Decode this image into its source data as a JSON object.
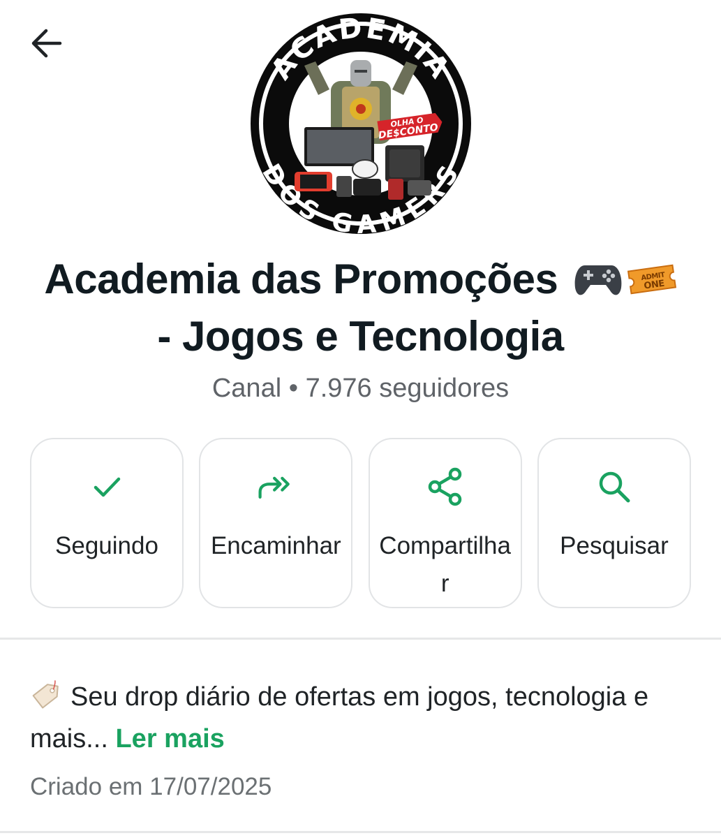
{
  "header": {
    "back_icon": "arrow-left-icon"
  },
  "logo": {
    "top_text": "ACADEMIA",
    "bottom_text": "DOS GAMERS",
    "tag_line1": "OLHA O",
    "tag_line2": "DE$CONTO"
  },
  "channel": {
    "title_line1": "Academia das Promoções",
    "title_line2": "- Jogos e Tecnologia",
    "ticket_text_top": "ADMIT",
    "ticket_text_bottom": "ONE",
    "subtitle": "Canal • 7.976 seguidores"
  },
  "actions": [
    {
      "label": "Seguindo",
      "icon": "check-icon"
    },
    {
      "label": "Encaminhar",
      "icon": "forward-icon"
    },
    {
      "label": "Compartilhar",
      "icon": "share-icon"
    },
    {
      "label": "Pesquisar",
      "icon": "search-icon"
    }
  ],
  "description": {
    "text": "Seu drop diário de ofertas em jogos, tecnologia e mais...",
    "read_more": "Ler mais",
    "icon": "price-tag-icon"
  },
  "created": "Criado em 17/07/2025",
  "colors": {
    "accent": "#1aa260",
    "text": "#111b21",
    "muted": "#5f6368"
  }
}
